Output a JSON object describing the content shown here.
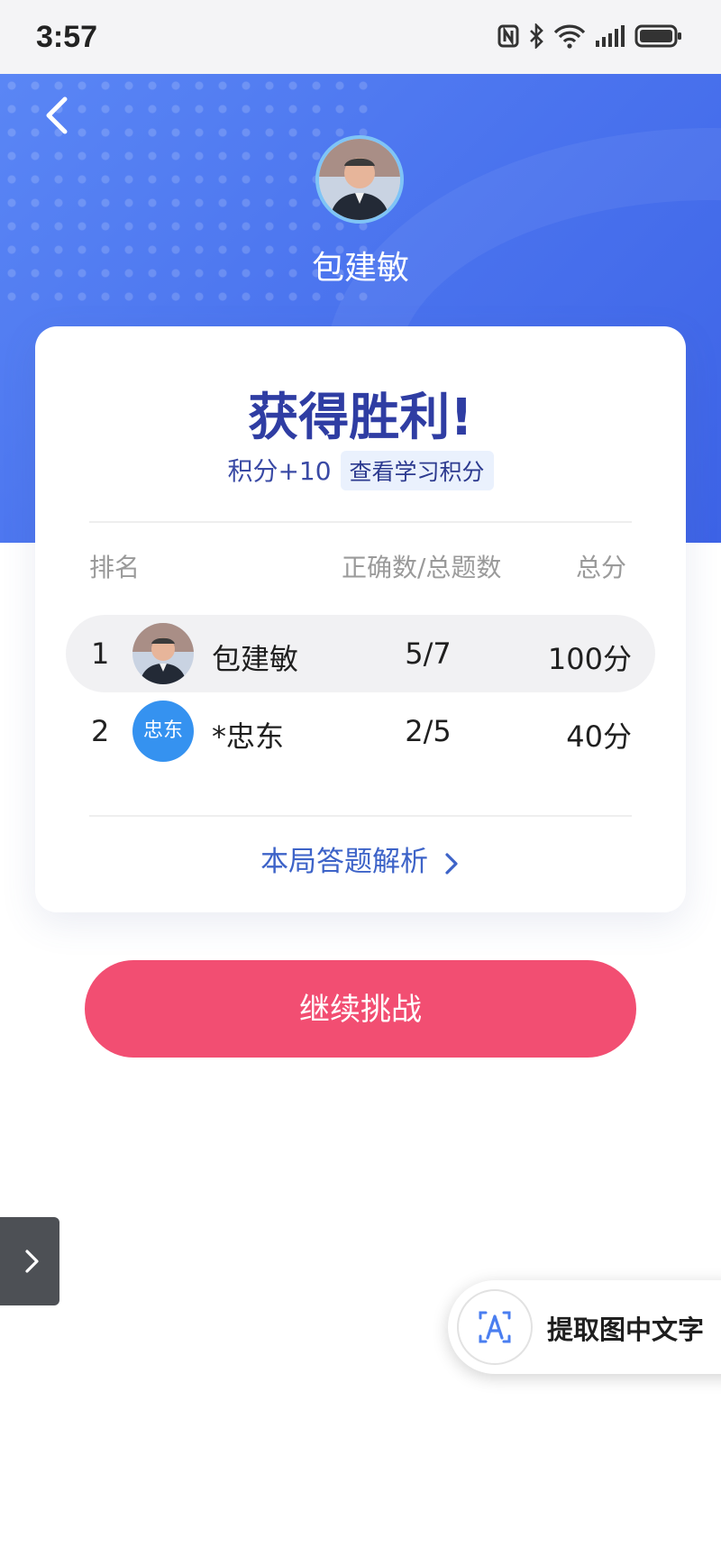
{
  "status_bar": {
    "time": "3:57"
  },
  "header": {
    "user_name": "包建敏"
  },
  "result": {
    "title": "获得胜利!",
    "points_text": "积分+10",
    "points_link": "查看学习积分"
  },
  "table": {
    "headers": {
      "rank": "排名",
      "correct_total": "正确数/总题数",
      "score": "总分"
    },
    "rows": [
      {
        "rank": "1",
        "avatar_text": "",
        "name": "包建敏",
        "count": "5/7",
        "score": "100分"
      },
      {
        "rank": "2",
        "avatar_text": "忠东",
        "name": "*忠东",
        "count": "2/5",
        "score": "40分"
      }
    ]
  },
  "analysis_link": "本局答题解析",
  "continue_button": "继续挑战",
  "ocr_button": {
    "label": "提取图中文字"
  },
  "colors": {
    "hero_blue": "#4a73ee",
    "title_navy": "#2f3da3",
    "button_pink": "#f24e72",
    "avatar_blue": "#3592f0"
  }
}
